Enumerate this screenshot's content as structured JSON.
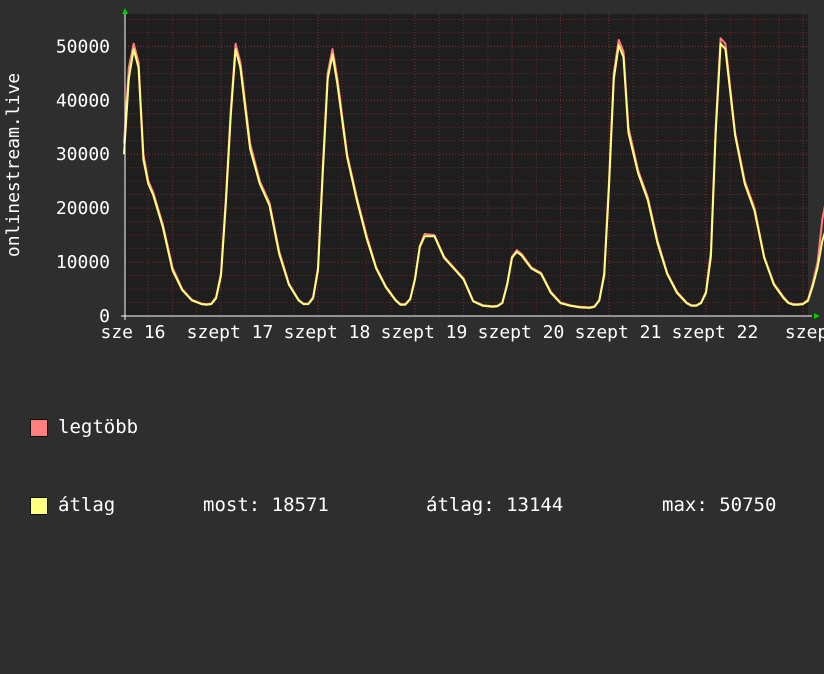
{
  "colors": {
    "max": "#ff7f7f",
    "avg": "#ffff7f",
    "background": "#2e2e2e",
    "plot_bg": "#1e1e1e",
    "grid": "#6b2a2a",
    "axis": "#ffffff"
  },
  "legend": {
    "max_label": "legtöbb",
    "avg_label": "átlag",
    "now": "most: 18571",
    "average": "átlag: 13144",
    "maximum": "max: 50750"
  },
  "chart_data": {
    "type": "line",
    "ylabel": "onlinestream.live",
    "ylim": [
      0,
      56000
    ],
    "y_ticks": [
      0,
      10000,
      20000,
      30000,
      40000,
      50000
    ],
    "x_tick_labels": [
      "sze 16",
      "szept 17",
      "szept 18",
      "szept 19",
      "szept 20",
      "szept 21",
      "szept 22",
      "szept"
    ],
    "x_start": 0,
    "x_end": 7.28,
    "grid": true,
    "series": [
      {
        "name": "legtöbb",
        "x": [
          0,
          0.05,
          0.1,
          0.15,
          0.2,
          0.25,
          0.3,
          0.4,
          0.5,
          0.6,
          0.7,
          0.8,
          0.85,
          0.9,
          0.95,
          1.0,
          1.05,
          1.1,
          1.15,
          1.2,
          1.3,
          1.4,
          1.5,
          1.6,
          1.7,
          1.8,
          1.85,
          1.9,
          1.95,
          2.0,
          2.05,
          2.1,
          2.15,
          2.2,
          2.3,
          2.4,
          2.5,
          2.6,
          2.7,
          2.8,
          2.85,
          2.9,
          2.95,
          3.0,
          3.05,
          3.1,
          3.2,
          3.3,
          3.4,
          3.5,
          3.6,
          3.7,
          3.8,
          3.85,
          3.9,
          3.95,
          4.0,
          4.05,
          4.1,
          4.2,
          4.3,
          4.4,
          4.5,
          4.6,
          4.7,
          4.8,
          4.85,
          4.9,
          4.95,
          5.0,
          5.05,
          5.1,
          5.15,
          5.2,
          5.3,
          5.4,
          5.5,
          5.6,
          5.7,
          5.8,
          5.85,
          5.9,
          5.95,
          6.0,
          6.05,
          6.1,
          6.15,
          6.2,
          6.3,
          6.4,
          6.5,
          6.6,
          6.7,
          6.8,
          6.85,
          6.9,
          6.95,
          7.0,
          7.05,
          7.1,
          7.15,
          7.2,
          7.28
        ],
        "values": [
          32000,
          46000,
          50500,
          47000,
          30000,
          25000,
          23000,
          17000,
          9000,
          5000,
          3000,
          2300,
          2200,
          2300,
          3500,
          8000,
          22000,
          38000,
          50500,
          47000,
          32000,
          25000,
          21000,
          12000,
          6000,
          3000,
          2300,
          2300,
          3500,
          9000,
          28000,
          45000,
          49500,
          44000,
          30000,
          22000,
          15000,
          9000,
          5500,
          3000,
          2200,
          2200,
          3200,
          7000,
          13000,
          15200,
          15000,
          11000,
          9000,
          7000,
          2800,
          2000,
          1800,
          1900,
          2500,
          6000,
          11000,
          12200,
          11500,
          9000,
          8000,
          4500,
          2500,
          2000,
          1700,
          1600,
          1800,
          3000,
          8000,
          25000,
          45000,
          51200,
          49000,
          35000,
          27000,
          22000,
          14000,
          8000,
          4500,
          2500,
          2000,
          2000,
          2500,
          4500,
          12000,
          35000,
          51500,
          50500,
          34000,
          25000,
          20000,
          11000,
          6000,
          3500,
          2500,
          2200,
          2200,
          2300,
          3000,
          6000,
          10000,
          18000,
          25500
        ]
      },
      {
        "name": "átlag",
        "x": [
          0,
          0.05,
          0.1,
          0.15,
          0.2,
          0.25,
          0.3,
          0.4,
          0.5,
          0.6,
          0.7,
          0.8,
          0.85,
          0.9,
          0.95,
          1.0,
          1.05,
          1.1,
          1.15,
          1.2,
          1.3,
          1.4,
          1.5,
          1.6,
          1.7,
          1.8,
          1.85,
          1.9,
          1.95,
          2.0,
          2.05,
          2.1,
          2.15,
          2.2,
          2.3,
          2.4,
          2.5,
          2.6,
          2.7,
          2.8,
          2.85,
          2.9,
          2.95,
          3.0,
          3.05,
          3.1,
          3.2,
          3.3,
          3.4,
          3.5,
          3.6,
          3.7,
          3.8,
          3.85,
          3.9,
          3.95,
          4.0,
          4.05,
          4.1,
          4.2,
          4.3,
          4.4,
          4.5,
          4.6,
          4.7,
          4.8,
          4.85,
          4.9,
          4.95,
          5.0,
          5.05,
          5.1,
          5.15,
          5.2,
          5.3,
          5.4,
          5.5,
          5.6,
          5.7,
          5.8,
          5.85,
          5.9,
          5.95,
          6.0,
          6.05,
          6.1,
          6.15,
          6.2,
          6.3,
          6.4,
          6.5,
          6.6,
          6.7,
          6.8,
          6.85,
          6.9,
          6.95,
          7.0,
          7.05,
          7.1,
          7.15,
          7.2,
          7.28
        ],
        "values": [
          30000,
          44000,
          49500,
          46000,
          29000,
          24500,
          22500,
          16500,
          8500,
          4800,
          2900,
          2200,
          2100,
          2200,
          3300,
          7500,
          21000,
          37000,
          49500,
          46000,
          31000,
          24500,
          20500,
          11500,
          5800,
          2900,
          2200,
          2200,
          3300,
          8500,
          27000,
          44000,
          48500,
          43000,
          29500,
          21500,
          14500,
          8800,
          5300,
          2900,
          2100,
          2100,
          3100,
          6800,
          12800,
          14800,
          14800,
          10800,
          8800,
          6800,
          2700,
          1900,
          1700,
          1800,
          2400,
          5800,
          10800,
          11900,
          11200,
          8800,
          7800,
          4300,
          2400,
          1900,
          1600,
          1500,
          1700,
          2900,
          7500,
          24000,
          44000,
          50200,
          48000,
          34000,
          26500,
          21500,
          13500,
          7800,
          4300,
          2400,
          1900,
          1900,
          2400,
          4300,
          11000,
          34000,
          50500,
          49500,
          33500,
          24500,
          19500,
          10800,
          5800,
          3300,
          2400,
          2100,
          2100,
          2200,
          2800,
          5500,
          9000,
          14000,
          18571
        ]
      }
    ]
  }
}
